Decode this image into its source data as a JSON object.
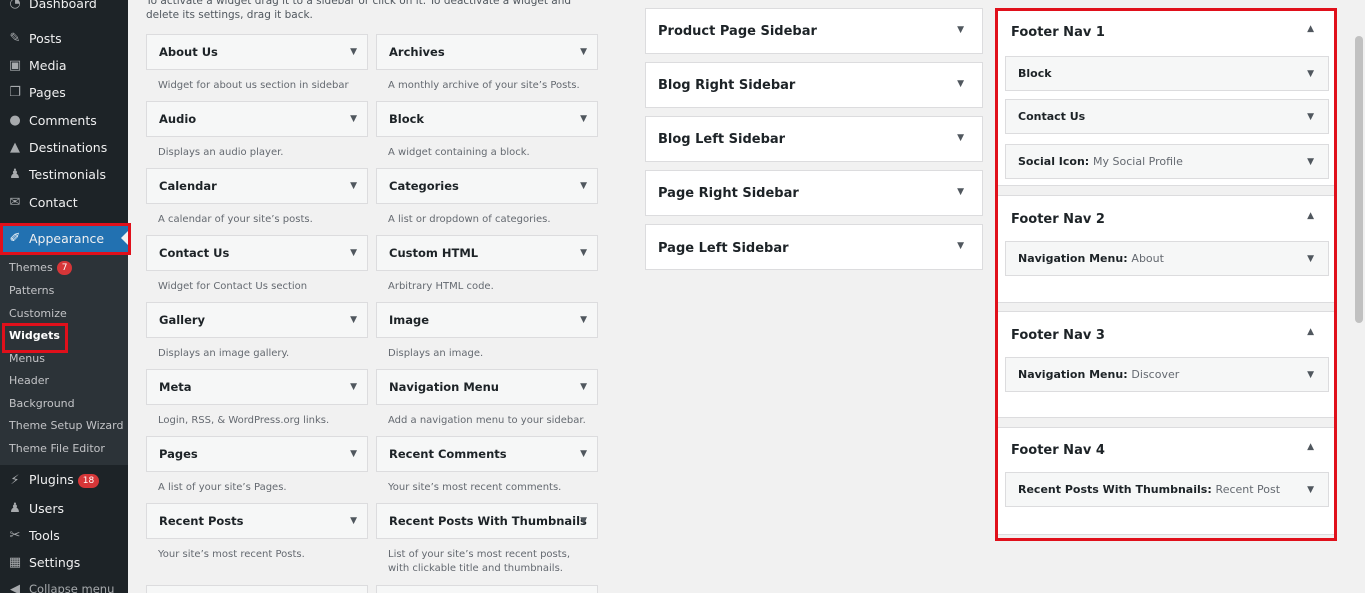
{
  "admin_menu": {
    "items": [
      {
        "label": "Dashboard",
        "icon": "dashboard-icon"
      },
      {
        "label": "Posts",
        "icon": "pin-icon"
      },
      {
        "label": "Media",
        "icon": "media-icon"
      },
      {
        "label": "Pages",
        "icon": "pages-icon"
      },
      {
        "label": "Comments",
        "icon": "comments-icon"
      },
      {
        "label": "Destinations",
        "icon": "destinations-icon"
      },
      {
        "label": "Testimonials",
        "icon": "person-icon"
      },
      {
        "label": "Contact",
        "icon": "mail-icon"
      },
      {
        "label": "Appearance",
        "icon": "brush-icon"
      },
      {
        "label": "Plugins",
        "icon": "plugin-icon"
      },
      {
        "label": "Users",
        "icon": "users-icon"
      },
      {
        "label": "Tools",
        "icon": "wrench-icon"
      },
      {
        "label": "Settings",
        "icon": "settings-icon"
      },
      {
        "label": "Collapse menu",
        "icon": "collapse-icon"
      }
    ],
    "plugins_badge": "18",
    "submenu": [
      {
        "label": "Themes"
      },
      {
        "label": "Patterns"
      },
      {
        "label": "Customize"
      },
      {
        "label": "Widgets"
      },
      {
        "label": "Menus"
      },
      {
        "label": "Header"
      },
      {
        "label": "Background"
      },
      {
        "label": "Theme Setup Wizard"
      },
      {
        "label": "Theme File Editor"
      }
    ],
    "themes_badge": "7"
  },
  "available_widgets": {
    "description": "To activate a widget drag it to a sidebar or click on it. To deactivate a widget and delete its settings, drag it back.",
    "items": [
      {
        "title": "About Us",
        "desc": "Widget for about us section in sidebar"
      },
      {
        "title": "Archives",
        "desc": "A monthly archive of your site’s Posts."
      },
      {
        "title": "Audio",
        "desc": "Displays an audio player."
      },
      {
        "title": "Block",
        "desc": "A widget containing a block."
      },
      {
        "title": "Calendar",
        "desc": "A calendar of your site’s posts."
      },
      {
        "title": "Categories",
        "desc": "A list or dropdown of categories."
      },
      {
        "title": "Contact Us",
        "desc": "Widget for Contact Us section"
      },
      {
        "title": "Custom HTML",
        "desc": "Arbitrary HTML code."
      },
      {
        "title": "Gallery",
        "desc": "Displays an image gallery."
      },
      {
        "title": "Image",
        "desc": "Displays an image."
      },
      {
        "title": "Meta",
        "desc": "Login, RSS, & WordPress.org links."
      },
      {
        "title": "Navigation Menu",
        "desc": "Add a navigation menu to your sidebar."
      },
      {
        "title": "Pages",
        "desc": "A list of your site’s Pages."
      },
      {
        "title": "Recent Comments",
        "desc": "Your site’s most recent comments."
      },
      {
        "title": "Recent Posts",
        "desc": "Your site’s most recent Posts."
      },
      {
        "title": "Recent Posts With Thumbnails",
        "desc": "List of your site’s most recent posts, with clickable title and thumbnails."
      }
    ]
  },
  "sidebars": [
    {
      "title": "Product Page Sidebar"
    },
    {
      "title": "Blog Right Sidebar"
    },
    {
      "title": "Blog Left Sidebar"
    },
    {
      "title": "Page Right Sidebar"
    },
    {
      "title": "Page Left Sidebar"
    }
  ],
  "footer_areas": [
    {
      "title": "Footer Nav 1",
      "widgets": [
        {
          "name": "Block",
          "sub": ""
        },
        {
          "name": "Contact Us",
          "sub": ""
        },
        {
          "name": "Social Icon",
          "sub": "My Social Profile"
        }
      ]
    },
    {
      "title": "Footer Nav 2",
      "widgets": [
        {
          "name": "Navigation Menu",
          "sub": "About"
        }
      ]
    },
    {
      "title": "Footer Nav 3",
      "widgets": [
        {
          "name": "Navigation Menu",
          "sub": "Discover"
        }
      ]
    },
    {
      "title": "Footer Nav 4",
      "widgets": [
        {
          "name": "Recent Posts With Thumbnails",
          "sub": "Recent Post"
        }
      ]
    }
  ],
  "colors": {
    "highlight": "#e0101b",
    "accent": "#2271b1",
    "menu_bg": "#1d2327"
  }
}
